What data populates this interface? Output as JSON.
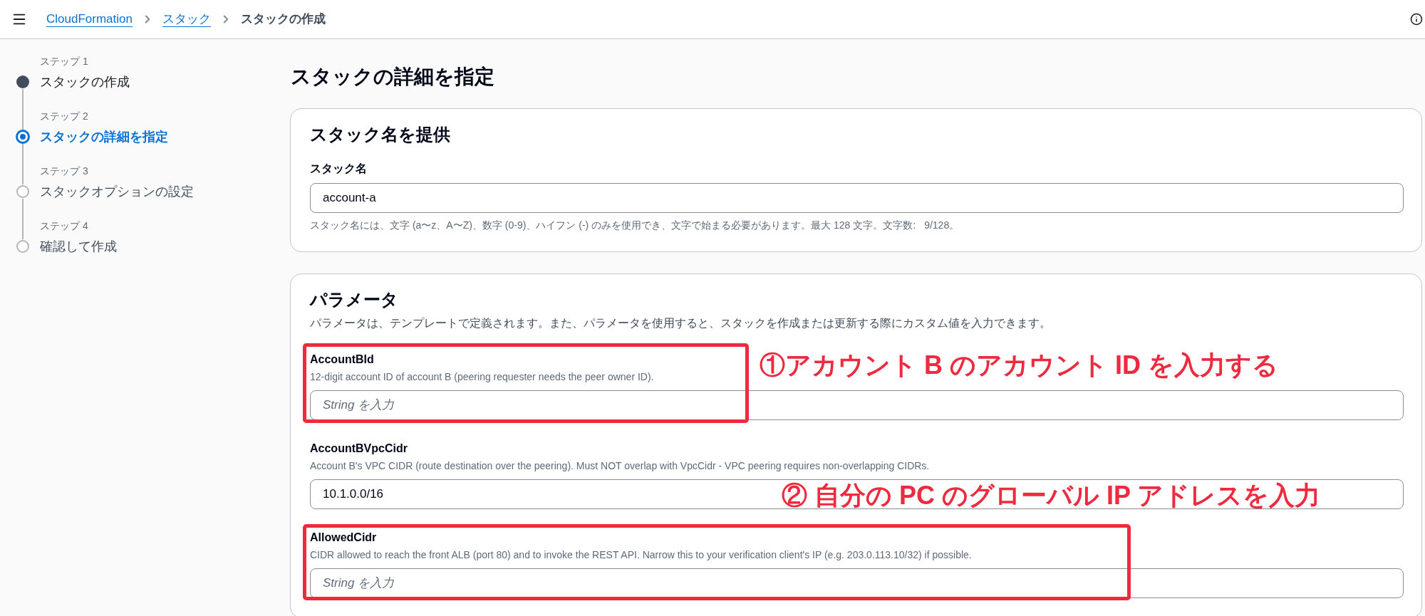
{
  "top_bar": {
    "breadcrumbs": [
      {
        "label": "CloudFormation",
        "kind": "link"
      },
      {
        "label": "スタック",
        "kind": "link"
      },
      {
        "label": "スタックの作成",
        "kind": "current"
      }
    ]
  },
  "steps": [
    {
      "label": "ステップ 1",
      "title": "スタックの作成",
      "completed": true,
      "selected": false
    },
    {
      "label": "ステップ 2",
      "title": "スタックの詳細を指定",
      "completed": false,
      "selected": true
    },
    {
      "label": "ステップ 3",
      "title": "スタックオプションの設定",
      "completed": false,
      "selected": false
    },
    {
      "label": "ステップ 4",
      "title": "確認して作成",
      "completed": false,
      "selected": false
    }
  ],
  "page_title": "スタックの詳細を指定",
  "stack_name_section": {
    "title": "スタック名を提供",
    "field": {
      "label": "スタック名",
      "value": "account-a"
    },
    "hint": "スタック名には、文字 (a〜z、A〜Z)、数字 (0-9)、ハイフン (-) のみを使用でき、文字で始まる必要があります。最大 128 文字。",
    "char_count": {
      "label": "文字数:",
      "value": "9/128。"
    }
  },
  "parameters_section": {
    "title": "パラメータ",
    "description": "パラメータは、テンプレートで定義されます。また、パラメータを使用すると、スタックを作成または更新する際にカスタム値を入力できます。",
    "parameters": [
      {
        "name": "AccountBId",
        "description": "12-digit account ID of account B (peering requester needs the peer owner ID).",
        "placeholder": "String を入力",
        "highlighted": true
      },
      {
        "name": "AccountBVpcCidr",
        "description": "Account B's VPC CIDR (route destination over the peering). Must NOT overlap with VpcCidr - VPC peering requires non-overlapping CIDRs.",
        "value": "10.1.0.0/16",
        "highlighted": false
      },
      {
        "name": "AllowedCidr",
        "description": "CIDR allowed to reach the front ALB (port 80) and to invoke the REST API. Narrow this to your verification client's IP (e.g. 203.0.113.10/32) if possible.",
        "placeholder": "String を入力",
        "highlighted": true
      }
    ]
  },
  "annotations": [
    {
      "text": "①アカウント B のアカウント ID を入力する"
    },
    {
      "text": "② 自分の PC のグローバル IP アドレスを入力"
    }
  ]
}
